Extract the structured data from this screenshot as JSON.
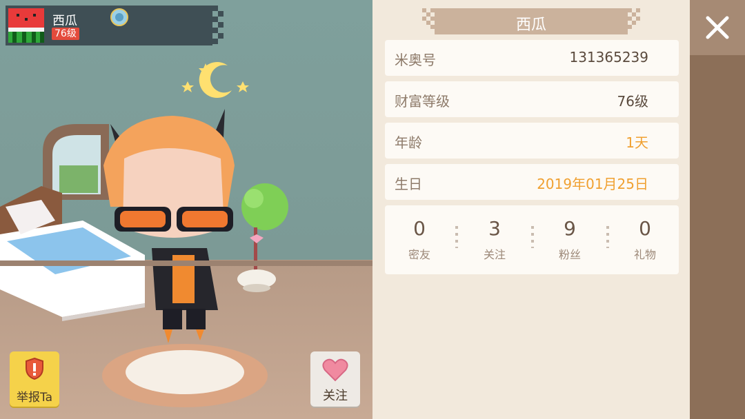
{
  "player": {
    "name": "西瓜",
    "level": "76级",
    "avatar_icon": "watermelon-avatar-icon",
    "medal_icon": "medal-icon"
  },
  "actions": {
    "report_label": "举报Ta",
    "follow_label": "关注"
  },
  "panel": {
    "title": "西瓜",
    "rows": [
      {
        "label": "米奥号",
        "value": "131365239",
        "color": "#5a4a3d"
      },
      {
        "label": "财富等级",
        "value": "76级",
        "color": "#5a4a3d"
      },
      {
        "label": "年龄",
        "value": "1天",
        "color": "#f0a030"
      },
      {
        "label": "生日",
        "value": "2019年01月25日",
        "color": "#f0a030"
      }
    ],
    "stats": [
      {
        "value": "0",
        "label": "密友"
      },
      {
        "value": "3",
        "label": "关注"
      },
      {
        "value": "9",
        "label": "粉丝"
      },
      {
        "value": "0",
        "label": "礼物"
      }
    ]
  },
  "close_icon": "close-icon",
  "colors": {
    "panel_bg": "#f2e9dc",
    "accent_orange": "#f0a030",
    "title_bar": "#cbb29c",
    "report_yellow": "#f5d24a",
    "heart_pink": "#f08aa0"
  }
}
